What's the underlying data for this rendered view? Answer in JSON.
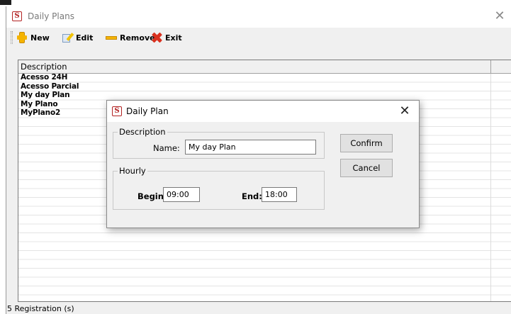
{
  "window": {
    "title": "Daily Plans",
    "app_icon": "S"
  },
  "toolbar": {
    "new_label": "New",
    "edit_label": "Edit",
    "remove_label": "Remove",
    "exit_label": "Exit"
  },
  "list": {
    "header_description": "Description",
    "items": [
      "Acesso 24H",
      "Acesso Parcial",
      "My day Plan",
      "My Plano",
      "MyPlano2"
    ]
  },
  "status": {
    "text": "5 Registration (s)"
  },
  "dialog": {
    "title": "Daily Plan",
    "app_icon": "S",
    "description_group": "Description",
    "name_label": "Name:",
    "name_value": "My day Plan",
    "hourly_group": "Hourly",
    "begin_label": "Begin:",
    "begin_value": "09:00",
    "end_label": "End:",
    "end_value": "18:00",
    "confirm_label": "Confirm",
    "cancel_label": "Cancel"
  },
  "colors": {
    "icon_red": "#b22222",
    "toolbar_yellow": "#f5b400",
    "exit_red": "#d9311f"
  }
}
